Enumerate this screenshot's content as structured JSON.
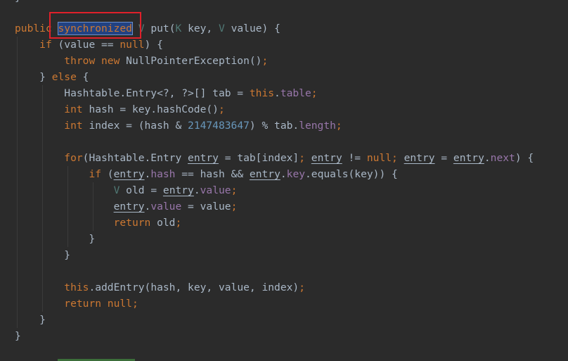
{
  "editor": {
    "top_fragment": "}",
    "lines": [
      "public synchronized V put(K key, V value) {",
      "    if (value == null) {",
      "        throw new NullPointerException();",
      "    } else {",
      "        Hashtable.Entry<?, ?>[] tab = this.table;",
      "        int hash = key.hashCode();",
      "        int index = (hash & 2147483647) % tab.length;",
      "",
      "        for(Hashtable.Entry entry = tab[index]; entry != null; entry = entry.next) {",
      "            if (entry.hash == hash && entry.key.equals(key)) {",
      "                V old = entry.value;",
      "                entry.value = value;",
      "                return old;",
      "            }",
      "        }",
      "",
      "        this.addEntry(hash, key, value, index);",
      "        return null;",
      "    }",
      "}"
    ],
    "selected_word": "synchronized",
    "colors": {
      "background": "#2b2b2b",
      "keyword": "#cc7832",
      "type_param": "#507874",
      "field": "#9876aa",
      "number": "#6897bb",
      "default": "#a9b7c6",
      "selection": "#214283",
      "annotation_box": "#e0202a"
    }
  }
}
